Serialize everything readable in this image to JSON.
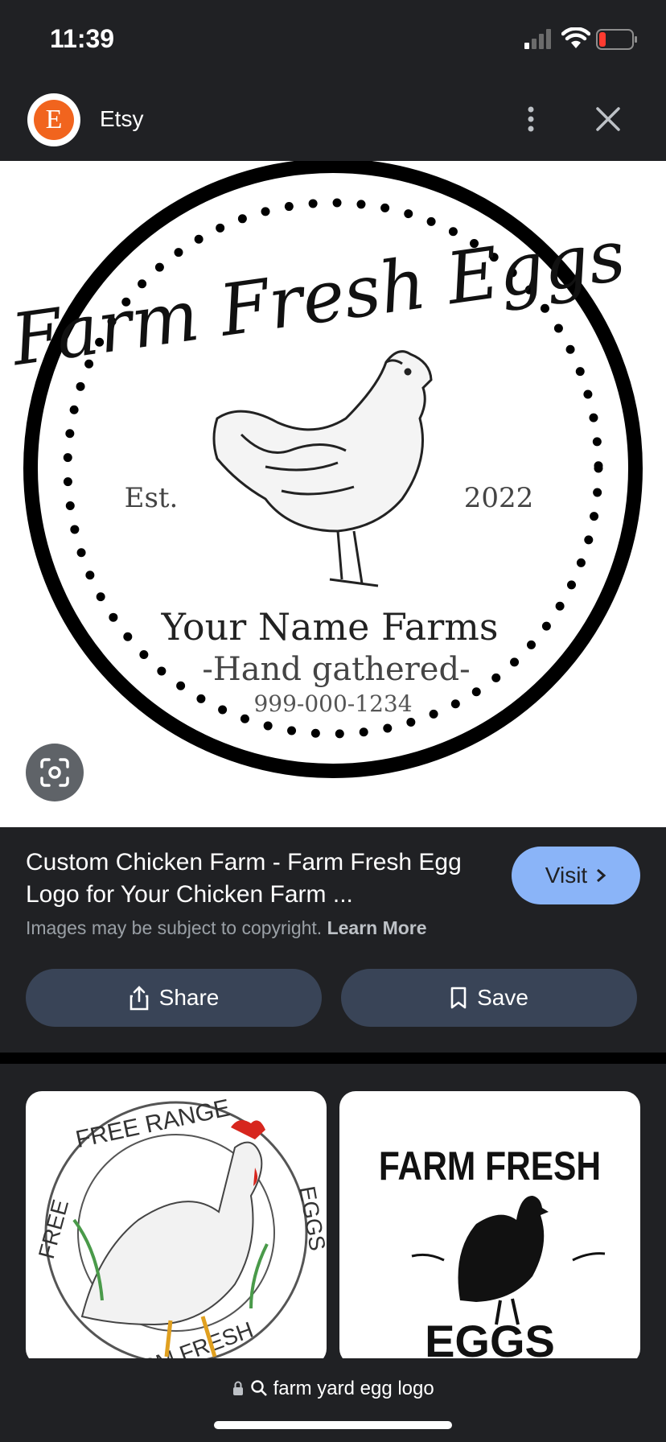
{
  "status_bar": {
    "time": "11:39"
  },
  "header": {
    "logo_letter": "E",
    "site_name": "Etsy"
  },
  "logo_image": {
    "script_title": "Farm Fresh Eggs",
    "est": "Est.",
    "year": "2022",
    "farm_name": "Your Name Farms",
    "tagline": "-Hand gathered-",
    "phone": "999-000-1234"
  },
  "result": {
    "title": "Custom Chicken Farm - Farm Fresh Egg Logo for Your Chicken Farm ...",
    "visit_label": "Visit",
    "copyright": "Images may be subject to copyright.",
    "learn_more": "Learn More",
    "share_label": "Share",
    "save_label": "Save"
  },
  "related": [
    {
      "top": "FREE RANGE",
      "left": "FREE",
      "right": "EGGS",
      "bottom": "FARM FRESH"
    },
    {
      "top": "FARM FRESH",
      "bottom": "EGGS"
    }
  ],
  "bottom_bar": {
    "url": "farm yard egg logo"
  },
  "colors": {
    "accent": "#8ab4f8",
    "etsy": "#f1641e",
    "button_bg": "#394457"
  }
}
